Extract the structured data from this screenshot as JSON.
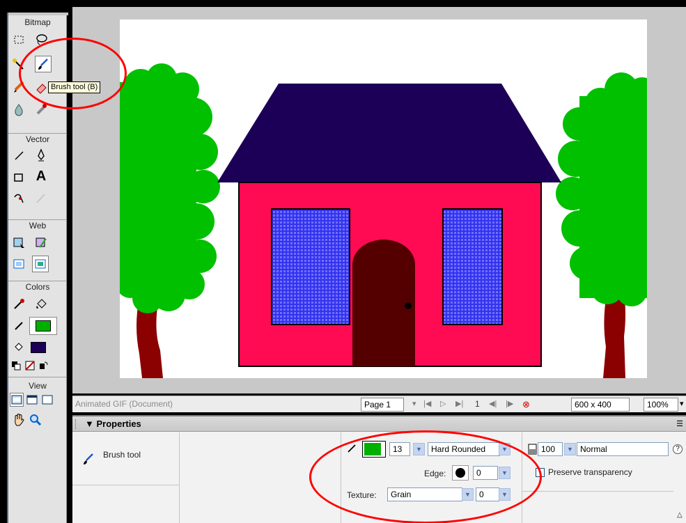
{
  "toolbar": {
    "sections": {
      "bitmap": "Bitmap",
      "vector": "Vector",
      "web": "Web",
      "colors": "Colors",
      "view": "View"
    },
    "text_tool_glyph": "A"
  },
  "tooltip": "Brush tool (B)",
  "canvas": {
    "colors": {
      "roof": "#1c0057",
      "wall": "#ff0b54",
      "window": "#3333ee",
      "door": "#550000",
      "tree": "#00c000",
      "trunk": "#8b0000"
    }
  },
  "status": {
    "document": "Animated GIF (Document)",
    "page": "Page 1",
    "frame": "1",
    "size": "600 x 400",
    "zoom": "100%"
  },
  "properties": {
    "title": "Properties",
    "tool_name": "Brush tool",
    "stroke_color": "#00b000",
    "brush_size": "13",
    "tip": "Hard Rounded",
    "edge_label": "Edge:",
    "edge_value": "0",
    "texture_label": "Texture:",
    "texture_value": "Grain",
    "texture_amount": "0",
    "opacity": "100",
    "blend": "Normal",
    "preserve_label": "Preserve transparency",
    "help": "?"
  },
  "colors": {
    "stroke_swatch": "#00b000",
    "fill_swatch": "#1c0057",
    "annotation": "#ff0000",
    "tooltip_bg": "#ffffe1"
  }
}
